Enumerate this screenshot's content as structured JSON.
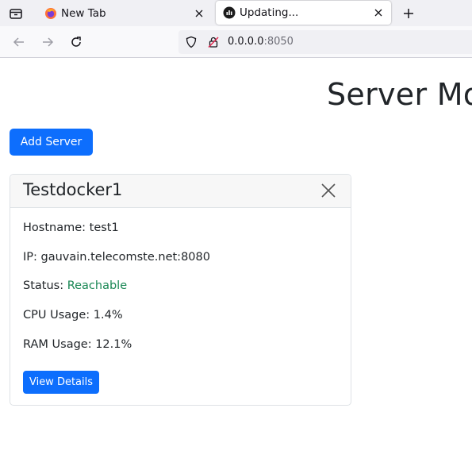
{
  "browser": {
    "tabs": [
      {
        "title": "New Tab",
        "icon": "firefox-icon",
        "active": false
      },
      {
        "title": "Updating...",
        "icon": "app-favicon",
        "active": true
      }
    ],
    "url": {
      "host": "0.0.0.0",
      "port": ":8050"
    }
  },
  "page": {
    "title": "Server Mo",
    "add_server_label": "Add Server"
  },
  "server_card": {
    "name": "Testdocker1",
    "hostname_label": "Hostname:",
    "hostname": "test1",
    "ip_label": "IP:",
    "ip": "gauvain.telecomste.net:8080",
    "status_label": "Status:",
    "status": "Reachable",
    "cpu_label": "CPU Usage:",
    "cpu": "1.4%",
    "ram_label": "RAM Usage:",
    "ram": "12.1%",
    "view_details_label": "View Details"
  },
  "colors": {
    "primary": "#0d6efd",
    "status_ok": "#198754"
  }
}
